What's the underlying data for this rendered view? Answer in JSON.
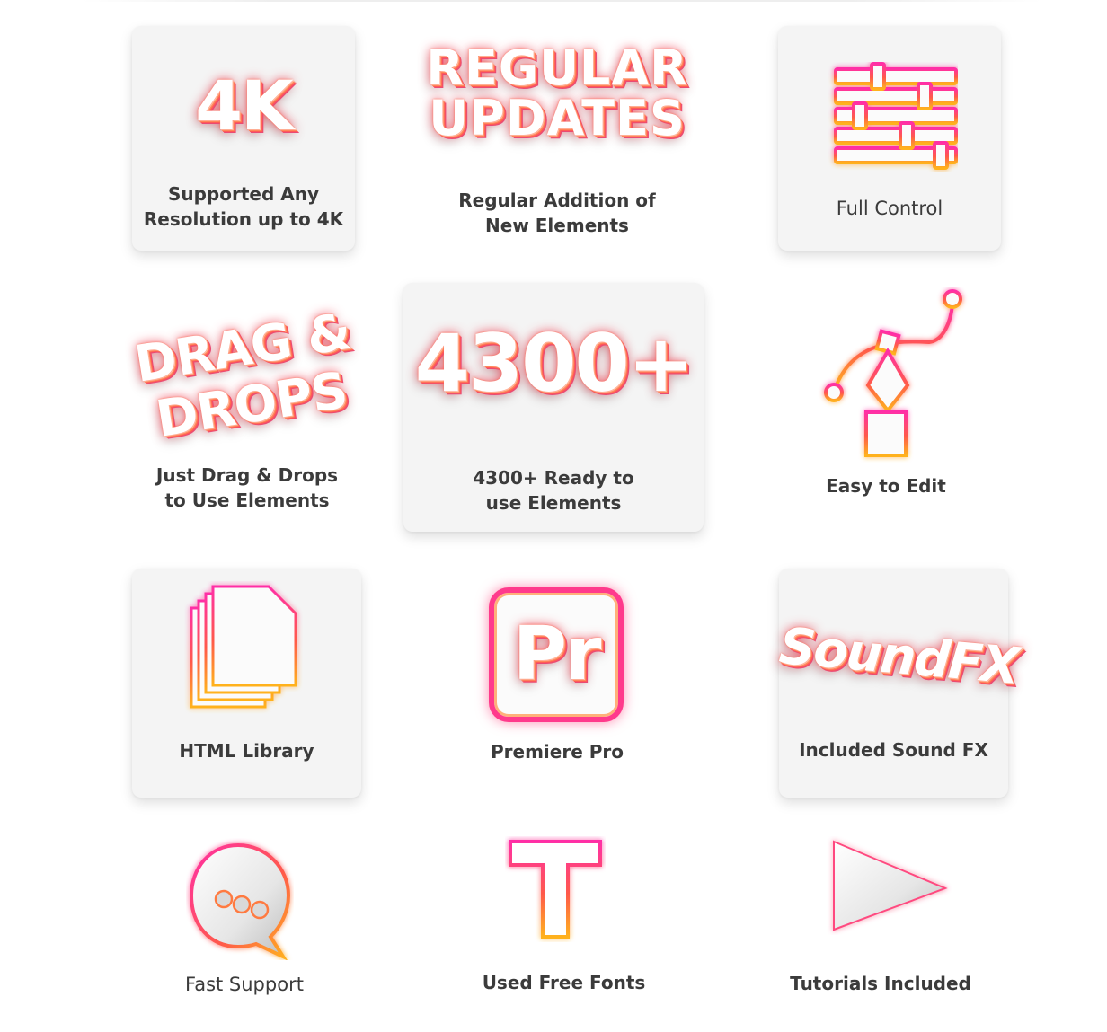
{
  "features": [
    {
      "id": "4k",
      "graphic_text": "4K",
      "label": "Supported Any\nResolution up to 4K"
    },
    {
      "id": "updates",
      "graphic_text": "REGULAR\nUPDATES",
      "label": "Regular Addition of\nNew Elements"
    },
    {
      "id": "control",
      "icon": "sliders-icon",
      "label": "Full Control"
    },
    {
      "id": "drag",
      "graphic_text": "DRAG &\nDROPS",
      "label": "Just Drag & Drops\nto Use Elements"
    },
    {
      "id": "elements",
      "graphic_text": "4300+",
      "label": "4300+ Ready to\nuse Elements"
    },
    {
      "id": "edit",
      "icon": "pen-tool-icon",
      "label": "Easy to Edit"
    },
    {
      "id": "html",
      "icon": "documents-icon",
      "label": "HTML Library"
    },
    {
      "id": "premiere",
      "graphic_text": "Pr",
      "icon": "premiere-pro-icon",
      "label": "Premiere Pro"
    },
    {
      "id": "sound",
      "graphic_text": "SoundFX",
      "label": "Included Sound FX"
    },
    {
      "id": "support",
      "icon": "chat-bubble-icon",
      "label": "Fast Support"
    },
    {
      "id": "fonts",
      "graphic_text": "T",
      "icon": "text-icon",
      "label": "Used Free Fonts"
    },
    {
      "id": "tutorials",
      "icon": "play-icon",
      "label": "Tutorials Included"
    }
  ],
  "colors": {
    "gradient_pink": "#ff2fa6",
    "gradient_red": "#ff4a55",
    "gradient_orange": "#ff9a2a",
    "gradient_yellow": "#ffd21e",
    "card_bg": "#f4f4f4",
    "label": "#3b3b3b"
  }
}
